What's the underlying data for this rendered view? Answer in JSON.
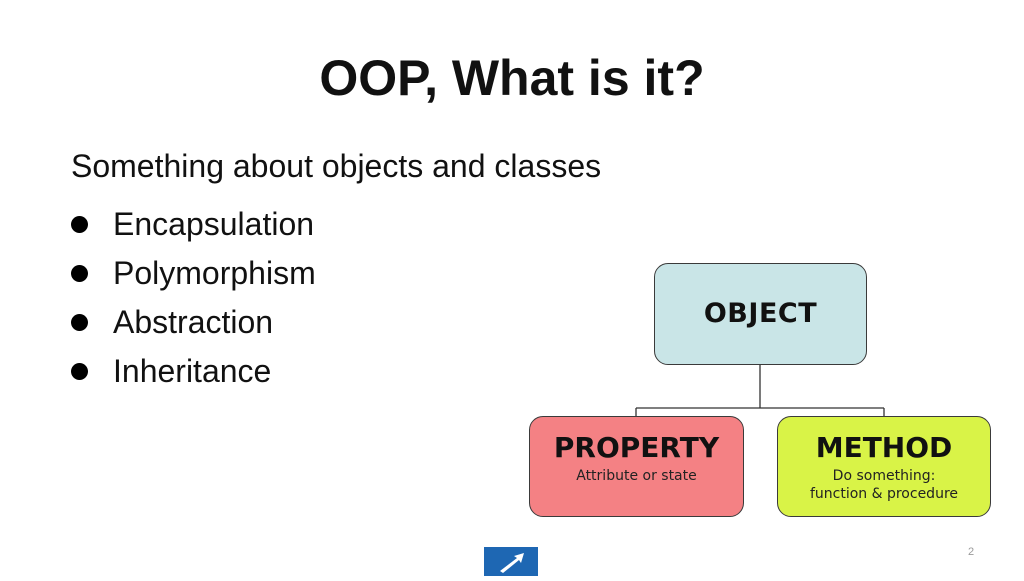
{
  "slide": {
    "title": "OOP, What is it?",
    "subtitle": "Something about objects and classes",
    "bullets": [
      "Encapsulation",
      "Polymorphism",
      "Abstraction",
      "Inheritance"
    ],
    "page_number": "2"
  },
  "diagram": {
    "object": {
      "title": "OBJECT",
      "color": "#c9e5e7"
    },
    "property": {
      "title": "PROPERTY",
      "subtitle": "Attribute or state",
      "color": "#f48184"
    },
    "method": {
      "title": "METHOD",
      "subtitle_line1": "Do something:",
      "subtitle_line2": "function & procedure",
      "color": "#d9f347"
    }
  },
  "logo": {
    "icon": "arrow-logo-icon",
    "color": "#1e67b3"
  }
}
